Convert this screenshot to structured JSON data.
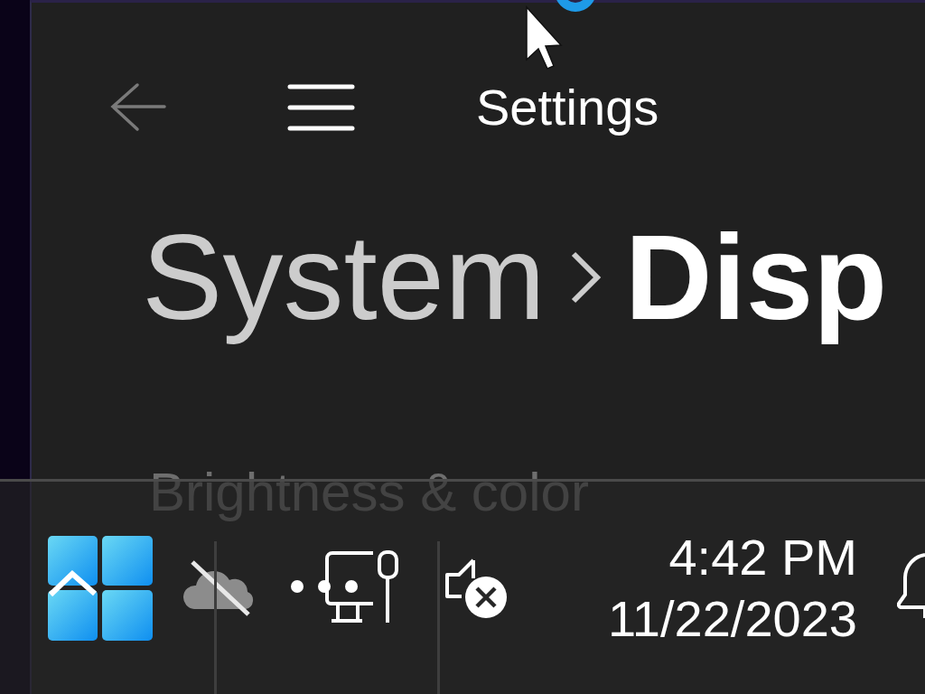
{
  "window": {
    "title": "Settings"
  },
  "breadcrumb": [
    {
      "label": "System",
      "current": false
    },
    {
      "label": "Disp",
      "current": true
    }
  ],
  "section_heading": "Brightness & color",
  "taskbar": {
    "clock": {
      "time": "4:42 PM",
      "date": "11/22/2023"
    }
  }
}
